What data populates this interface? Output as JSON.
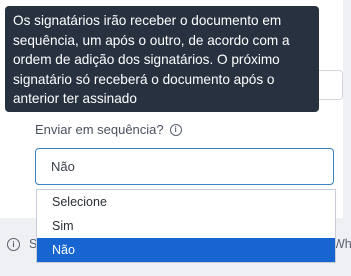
{
  "tooltip": {
    "text": "Os signatários irão receber o documento em sequência, um após o outro, de acordo com a ordem de adição dos signatários. O próximo signatário só receberá o documento após o anterior ter assinado"
  },
  "field": {
    "label": "Enviar em sequência?",
    "info_icon": "info-circle-icon",
    "selected_value": "Não"
  },
  "dropdown": {
    "options": [
      "Selecione",
      "Sim",
      "Não"
    ],
    "selected_index": 2
  },
  "background_row": {
    "left_text": "S",
    "right_text": "Wh",
    "icon": "info-circle-icon"
  },
  "colors": {
    "tooltip_bg": "#283140",
    "focus_border": "#3b82c4",
    "selected_option_bg": "#1765d0"
  }
}
